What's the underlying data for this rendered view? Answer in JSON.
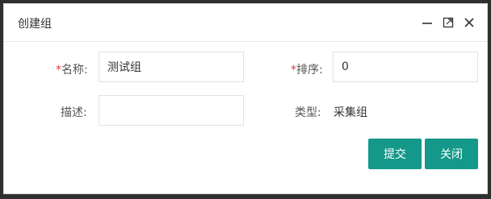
{
  "dialog": {
    "title": "创建组",
    "icons": [
      "minimize-icon",
      "maximize-icon",
      "close-icon"
    ]
  },
  "form": {
    "name": {
      "required_mark": "*",
      "label": "名称:",
      "value": "测试组"
    },
    "order": {
      "required_mark": "*",
      "label": "排序:",
      "value": "0"
    },
    "description": {
      "label": "描述:",
      "value": ""
    },
    "type": {
      "label": "类型:",
      "value": "采集组"
    }
  },
  "buttons": {
    "submit_label": "提交",
    "close_label": "关闭"
  },
  "colors": {
    "primary": "#14988a",
    "required": "#e0353c"
  }
}
